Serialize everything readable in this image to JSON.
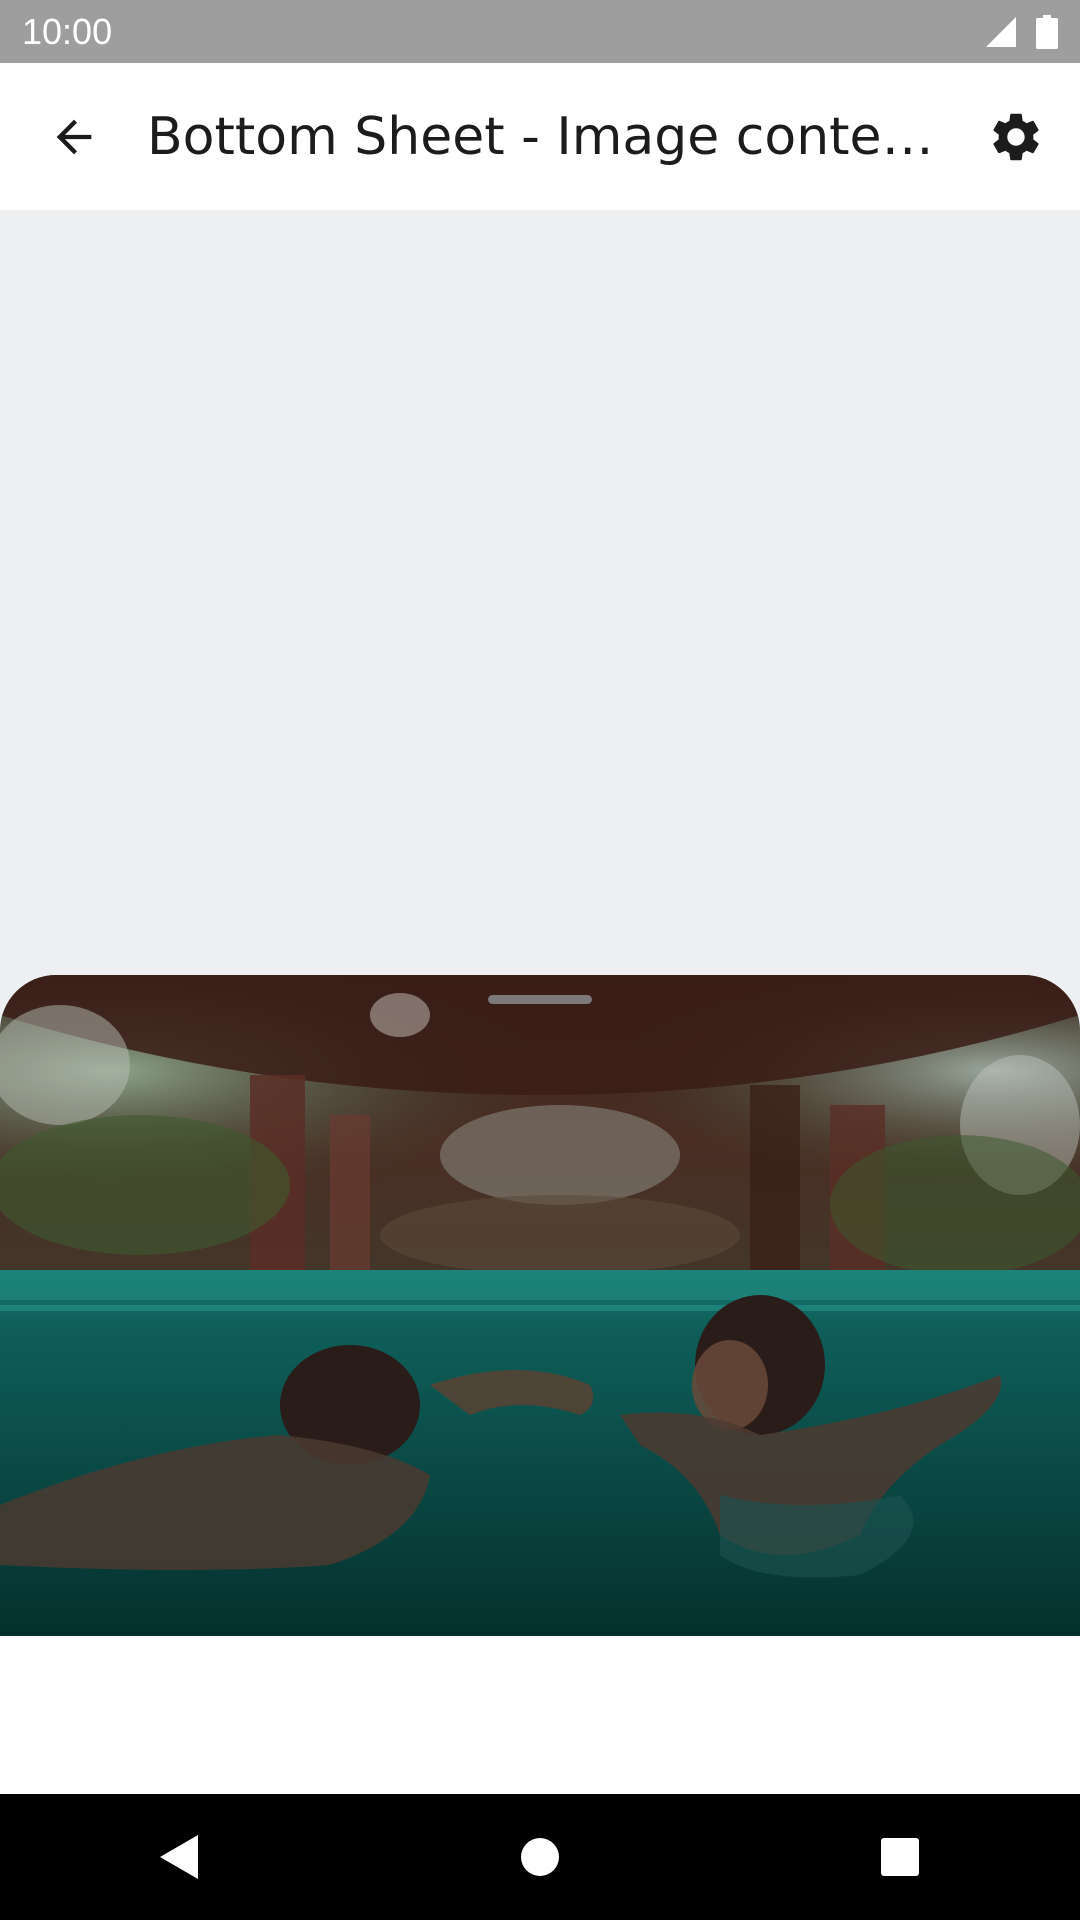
{
  "status_bar": {
    "time": "10:00",
    "icons": [
      "cell-signal-icon",
      "battery-icon"
    ]
  },
  "app_bar": {
    "title": "Bottom Sheet - Image conten…",
    "back_icon": "arrow-back-icon",
    "settings_icon": "gear-icon"
  },
  "bottom_sheet": {
    "image_description": "underwater-pool-photo",
    "handle": "drag-handle"
  },
  "nav_bar": {
    "buttons": [
      "back-triangle-icon",
      "home-circle-icon",
      "recents-square-icon"
    ]
  },
  "colors": {
    "status_bar": "#9e9e9e",
    "app_bar": "#ffffff",
    "background": "#eeeff1",
    "nav_bar": "#000000",
    "water": "#0d5a55"
  }
}
